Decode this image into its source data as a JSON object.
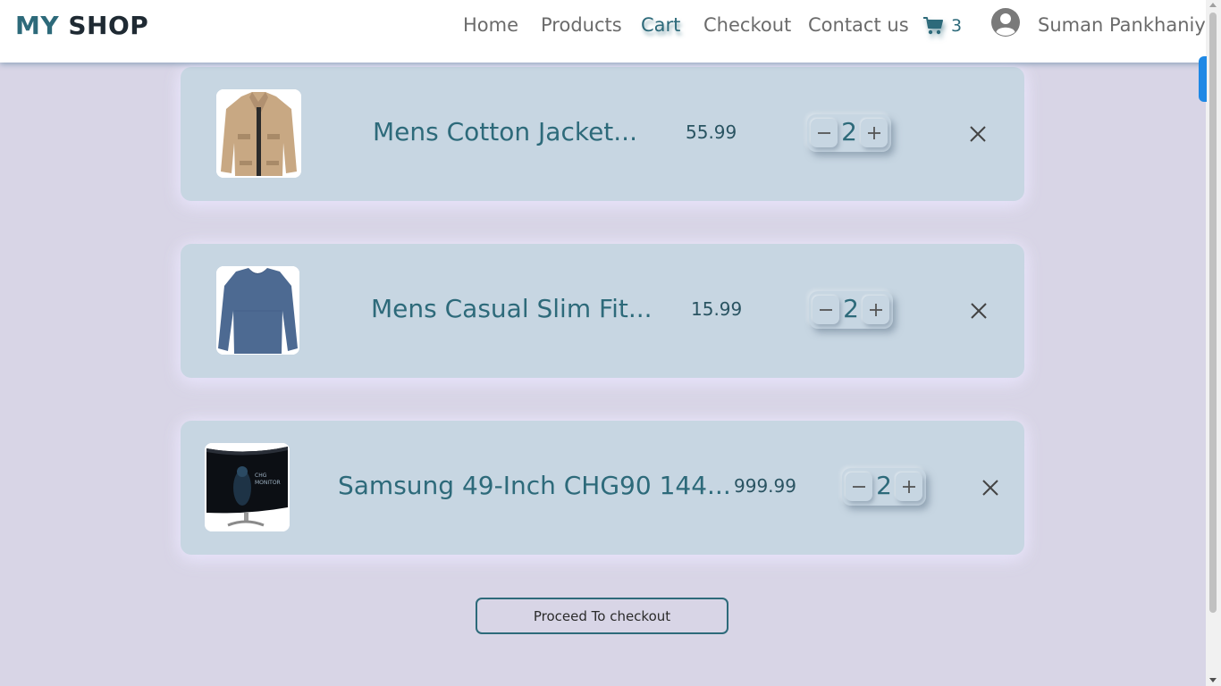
{
  "header": {
    "brand_part1": "MY",
    "brand_part2": "SHOP",
    "nav": {
      "home": "Home",
      "products": "Products",
      "cart": "Cart",
      "checkout": "Checkout",
      "contact": "Contact us"
    },
    "cart_count": "3",
    "cart_icon": "shopping-cart-icon",
    "avatar_icon": "user-circle-icon",
    "user_name": "Suman Pankhaniya"
  },
  "cart": {
    "items": [
      {
        "name": "Mens Cotton Jacket...",
        "price": "55.99",
        "quantity": "2",
        "image": "jacket-image"
      },
      {
        "name": "Mens Casual Slim Fit...",
        "price": "15.99",
        "quantity": "2",
        "image": "shirt-image"
      },
      {
        "name": "Samsung 49-Inch CHG90 144...",
        "price": "999.99",
        "quantity": "2",
        "image": "monitor-image"
      }
    ],
    "proceed_label": "Proceed To checkout"
  },
  "colors": {
    "accent": "#2d6a7a",
    "background": "#d8d5e6",
    "card": "#c7d6e2"
  }
}
